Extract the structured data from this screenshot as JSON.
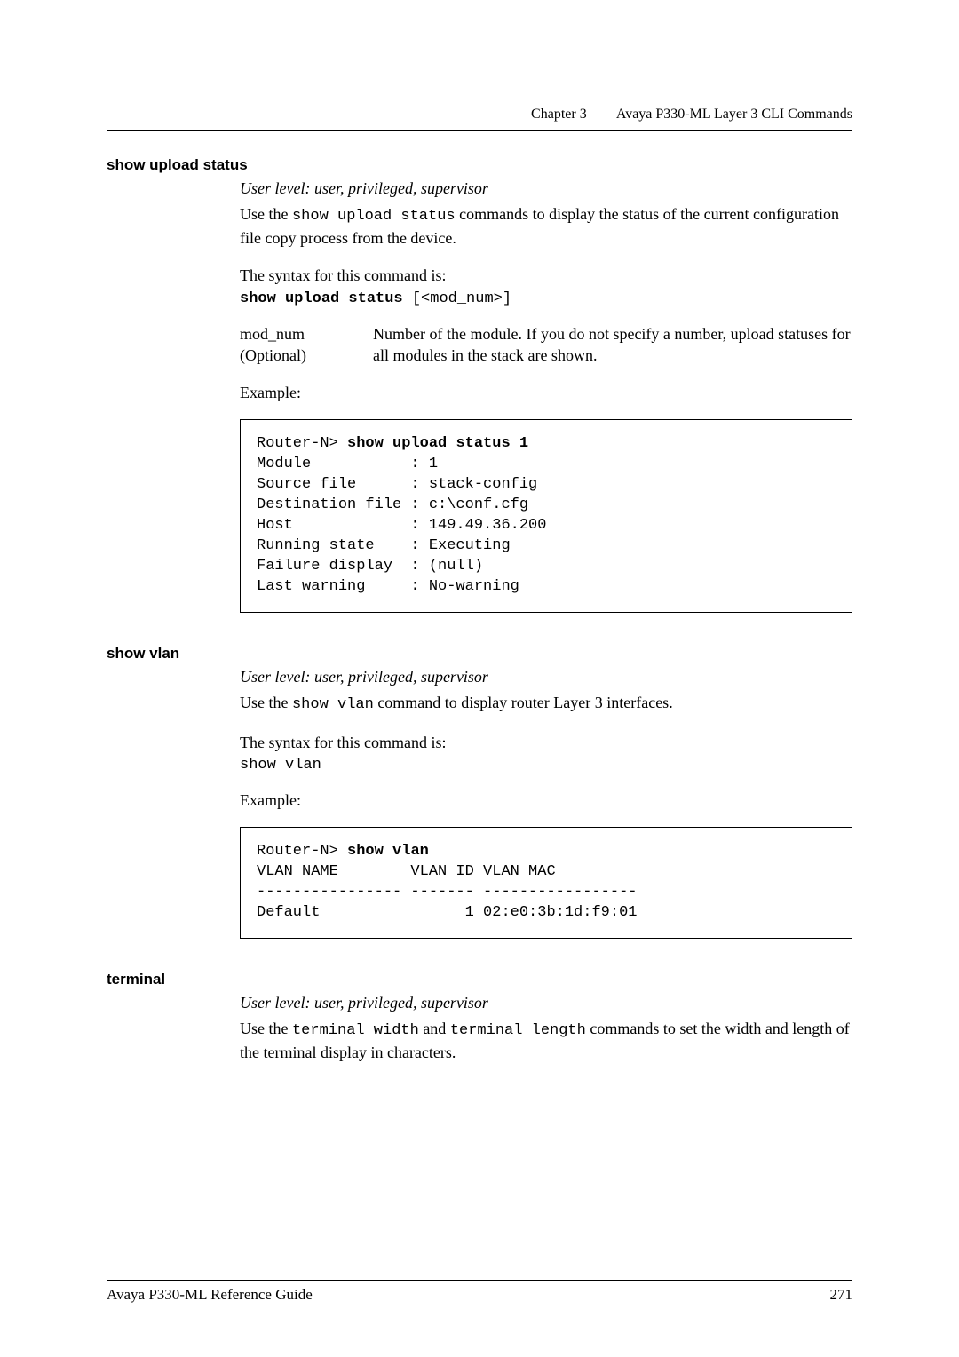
{
  "header": {
    "chapter": "Chapter 3",
    "title": "Avaya P330-ML Layer 3 CLI Commands"
  },
  "sections": {
    "upload": {
      "heading": "show upload status",
      "user_level": "User level: user, privileged, supervisor",
      "intro_pre": "Use the ",
      "intro_cmd": "show upload status",
      "intro_post": " commands to display the status of the current configuration file copy process from the device.",
      "syntax_lead": "The syntax for this command is:",
      "syntax_bold": "show upload status",
      "syntax_tail": " [<mod_num>]",
      "param_name": "mod_num",
      "param_opt": "(Optional)",
      "param_desc": "Number of the module. If you do not specify a number, upload statuses for all modules in the stack are shown.",
      "example_label": "Example:",
      "code": "Router-N> show upload status 1\nModule           : 1\nSource file      : stack-config\nDestination file : c:\\conf.cfg\nHost             : 149.49.36.200\nRunning state    : Executing\nFailure display  : (null)\nLast warning     : No-warning",
      "code_bold_prefix": "Router-N> ",
      "code_bold_cmd": "show upload status 1",
      "code_rest": "Module           : 1\nSource file      : stack-config\nDestination file : c:\\conf.cfg\nHost             : 149.49.36.200\nRunning state    : Executing\nFailure display  : (null)\nLast warning     : No-warning"
    },
    "vlan": {
      "heading": "show vlan",
      "user_level": "User level: user, privileged, supervisor",
      "intro_pre": "Use the ",
      "intro_cmd": "show vlan",
      "intro_post": " command to display router Layer 3 interfaces.",
      "syntax_lead": "The syntax for this command is:",
      "syntax_line": "show vlan",
      "example_label": "Example:",
      "code_bold_prefix": "Router-N> ",
      "code_bold_cmd": "show vlan",
      "code_rest": "VLAN NAME        VLAN ID VLAN MAC\n---------------- ------- -----------------\nDefault                1 02:e0:3b:1d:f9:01"
    },
    "terminal": {
      "heading": "terminal",
      "user_level": "User level: user, privileged, supervisor",
      "intro_pre": "Use the ",
      "intro_cmd1": "terminal width",
      "intro_mid": " and ",
      "intro_cmd2": "terminal length",
      "intro_post": " commands to set the width and length of the terminal display in characters."
    }
  },
  "footer": {
    "left": "Avaya P330-ML Reference Guide",
    "right": "271"
  }
}
